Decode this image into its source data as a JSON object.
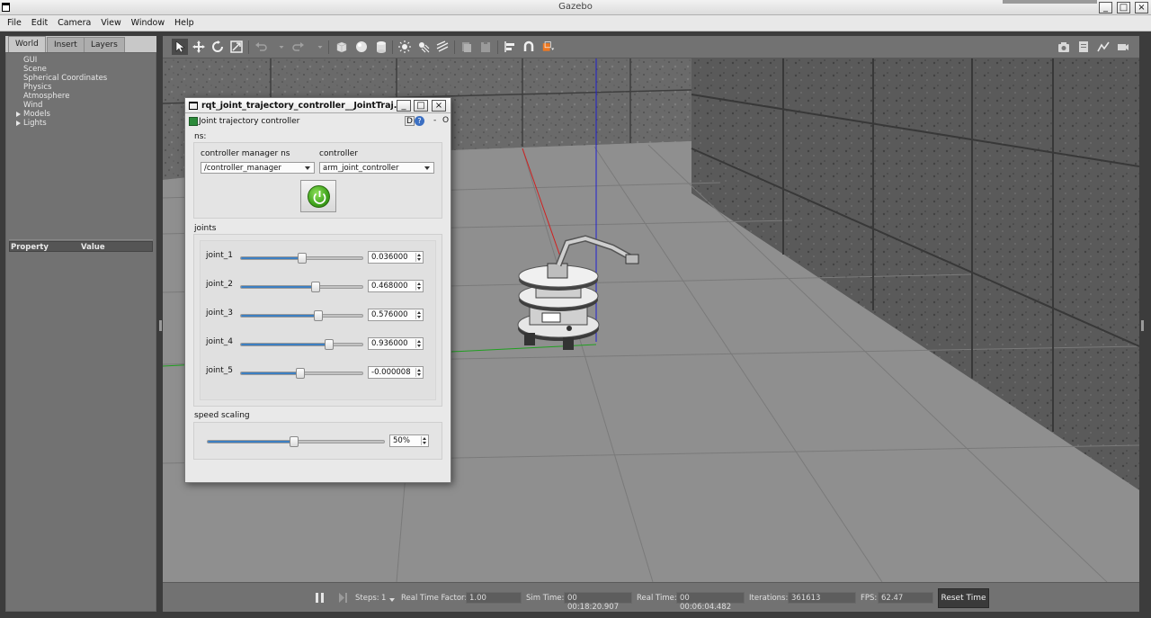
{
  "window": {
    "title": "Gazebo"
  },
  "menu": [
    "File",
    "Edit",
    "Camera",
    "View",
    "Window",
    "Help"
  ],
  "left_panel": {
    "tabs": [
      "World",
      "Insert",
      "Layers"
    ],
    "active_tab": "World",
    "tree": [
      "GUI",
      "Scene",
      "Spherical Coordinates",
      "Physics",
      "Atmosphere",
      "Wind",
      "Models",
      "Lights"
    ],
    "expandable": [
      "Models",
      "Lights"
    ],
    "property_header": {
      "property": "Property",
      "value": "Value"
    }
  },
  "toolbar": {
    "tools": [
      "select-icon",
      "translate-icon",
      "rotate-icon",
      "scale-icon",
      "undo-icon",
      "redo-icon",
      "box-icon",
      "sphere-icon",
      "cylinder-icon",
      "pointlight-icon",
      "spotlight-icon",
      "directionallight-icon",
      "copy-icon",
      "paste-icon",
      "align-icon",
      "snap-icon",
      "color-icon"
    ],
    "right_tools": [
      "screenshot-icon",
      "log-icon",
      "plot-icon",
      "video-icon"
    ]
  },
  "dialog": {
    "title": "rqt_joint_trajectory_controller__JointTraj...",
    "plugin_label": "Joint trajectory controller",
    "badge_d": "D",
    "badge_help": "?",
    "dash": "-",
    "close_o": "O",
    "ns_label": "ns:",
    "cm_ns_label": "controller manager ns",
    "cm_ns_value": "/controller_manager",
    "controller_label": "controller",
    "controller_value": "arm_joint_controller",
    "joints_label": "joints",
    "joints": [
      {
        "name": "joint_1",
        "value": "0.036000",
        "fraction": 0.5
      },
      {
        "name": "joint_2",
        "value": "0.468000",
        "fraction": 0.62
      },
      {
        "name": "joint_3",
        "value": "0.576000",
        "fraction": 0.65
      },
      {
        "name": "joint_4",
        "value": "0.936000",
        "fraction": 0.74
      },
      {
        "name": "joint_5",
        "value": "-0.000008",
        "fraction": 0.49
      }
    ],
    "speed_label": "speed scaling",
    "speed_value": "50%",
    "speed_fraction": 0.49
  },
  "bottom_bar": {
    "steps_label": "Steps:",
    "steps_value": "1",
    "rtf_label": "Real Time Factor:",
    "rtf_value": "1.00",
    "sim_label": "Sim Time:",
    "sim_value": "00 00:18:20.907",
    "real_label": "Real Time:",
    "real_value": "00 00:06:04.482",
    "iter_label": "Iterations:",
    "iter_value": "361613",
    "fps_label": "FPS:",
    "fps_value": "62.47",
    "reset_label": "Reset Time"
  },
  "colors": {
    "accent_blue": "#3c7fc2",
    "power_green": "#3fa41c",
    "ground": "#8e8e8e"
  }
}
